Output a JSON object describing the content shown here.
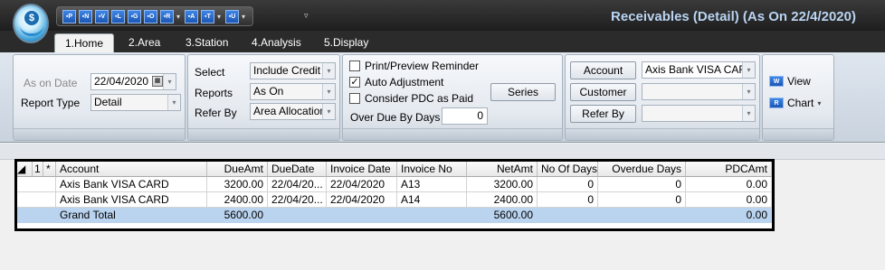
{
  "window": {
    "title": "Receivables (Detail) (As On 22/4/2020)"
  },
  "app_menu": {
    "symbol": "$"
  },
  "quick_access": [
    {
      "label": "P",
      "has_dropdown": false
    },
    {
      "label": "N",
      "has_dropdown": false
    },
    {
      "label": "V",
      "has_dropdown": false
    },
    {
      "label": "L",
      "has_dropdown": false
    },
    {
      "label": "G",
      "has_dropdown": false
    },
    {
      "label": "O",
      "has_dropdown": false
    },
    {
      "label": "R",
      "has_dropdown": true
    },
    {
      "label": "A",
      "has_dropdown": false
    },
    {
      "label": "T",
      "has_dropdown": true
    },
    {
      "label": "U",
      "has_dropdown": true
    }
  ],
  "ribbon_tabs": [
    {
      "label": "1.Home",
      "active": true
    },
    {
      "label": "2.Area",
      "active": false
    },
    {
      "label": "3.Station",
      "active": false
    },
    {
      "label": "4.Analysis",
      "active": false
    },
    {
      "label": "5.Display",
      "active": false
    }
  ],
  "report_group": {
    "as_on_date_label": "As on Date",
    "as_on_date_value": "22/04/2020",
    "report_type_label": "Report Type",
    "report_type_value": "Detail"
  },
  "select_group": {
    "select_label": "Select",
    "select_value": "Include Credit N",
    "reports_label": "Reports",
    "reports_value": "As On",
    "refer_by_label": "Refer By",
    "refer_by_value": "Area Allocation"
  },
  "options_group": {
    "print_preview_label": "Print/Preview Reminder",
    "print_preview_checked": false,
    "auto_adjustment_label": "Auto Adjustment",
    "auto_adjustment_checked": true,
    "consider_pdc_label": "Consider PDC as Paid",
    "consider_pdc_checked": false,
    "series_button": "Series",
    "over_due_label": "Over Due By Days",
    "over_due_value": "0"
  },
  "account_group": {
    "account_button": "Account",
    "account_value": "Axis Bank VISA CARD",
    "customer_button": "Customer",
    "customer_value": "",
    "refer_by_button": "Refer By",
    "refer_by_value": ""
  },
  "view_group": {
    "view_label": "View",
    "chart_label": "Chart"
  },
  "grid": {
    "header_num": "1",
    "header_star": "*",
    "columns": [
      "Account",
      "DueAmt",
      "DueDate",
      "Invoice Date",
      "Invoice No",
      "NetAmt",
      "No Of Days",
      "Overdue Days",
      "PDCAmt"
    ],
    "rows": [
      {
        "account": "Axis Bank VISA CARD",
        "due_amt": "3200.00",
        "due_date": "22/04/20...",
        "invoice_date": "22/04/2020",
        "invoice_no": "A13",
        "net_amt": "3200.00",
        "no_of_days": "0",
        "overdue_days": "0",
        "pdc_amt": "0.00"
      },
      {
        "account": "Axis Bank VISA CARD",
        "due_amt": "2400.00",
        "due_date": "22/04/20...",
        "invoice_date": "22/04/2020",
        "invoice_no": "A14",
        "net_amt": "2400.00",
        "no_of_days": "0",
        "overdue_days": "0",
        "pdc_amt": "0.00"
      }
    ],
    "total": {
      "label": "Grand Total",
      "due_amt": "5600.00",
      "net_amt": "5600.00",
      "pdc_amt": "0.00"
    }
  }
}
